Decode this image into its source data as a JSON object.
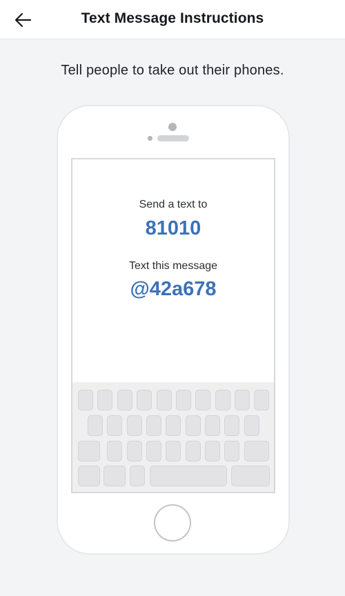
{
  "header": {
    "title": "Text Message Instructions",
    "back_icon": "arrow-left-icon"
  },
  "main": {
    "instruction": "Tell people to take out their phones."
  },
  "phone": {
    "send_label": "Send a text to",
    "number": "81010",
    "message_label": "Text this message",
    "code": "@42a678"
  },
  "colors": {
    "accent": "#3c72b7",
    "background": "#f3f4f6",
    "keyboard": "#efeff0"
  }
}
